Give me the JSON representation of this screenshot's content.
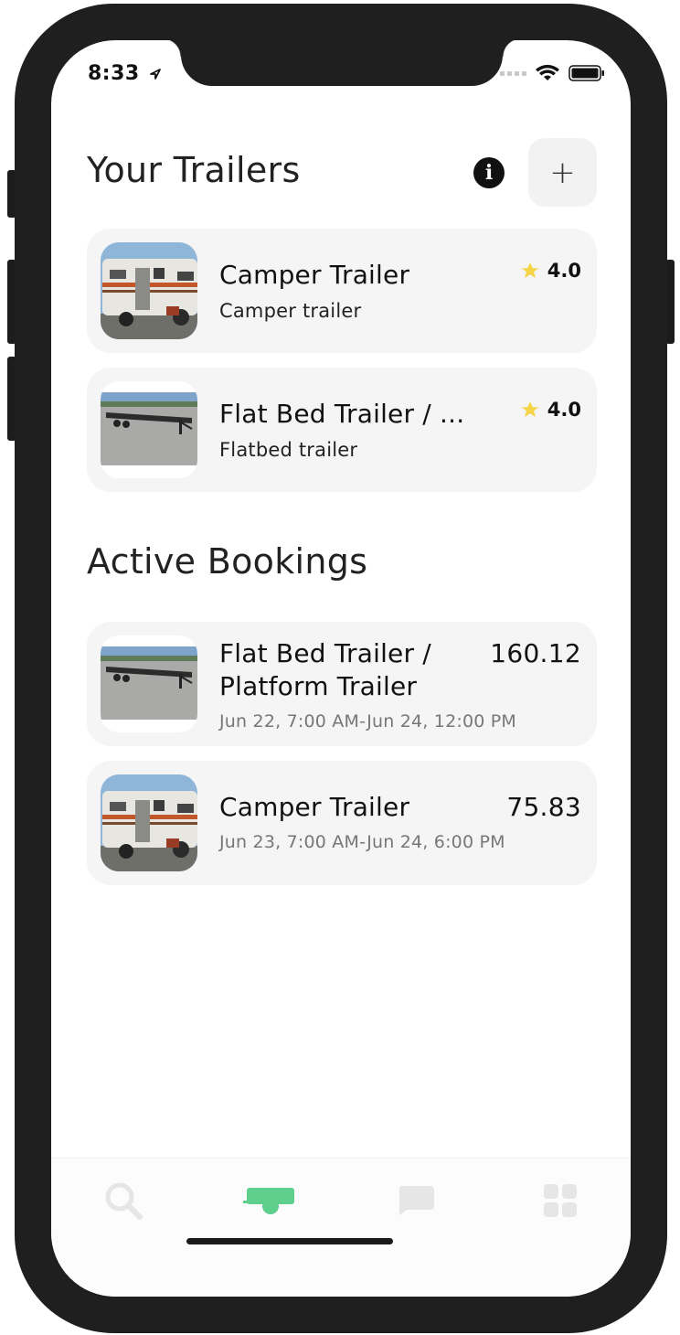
{
  "status_bar": {
    "time": "8:33"
  },
  "header": {
    "title": "Your Trailers",
    "add_label": "+"
  },
  "trailers": [
    {
      "title": "Camper Trailer",
      "subtitle": "Camper trailer",
      "rating": "4.0",
      "image": "camper"
    },
    {
      "title": "Flat Bed Trailer / ...",
      "subtitle": "Flatbed trailer",
      "rating": "4.0",
      "image": "flatbed"
    }
  ],
  "bookings_section": {
    "title": "Active Bookings"
  },
  "bookings": [
    {
      "title_line1": "Flat Bed Trailer /",
      "title_line2": "Platform Trailer",
      "price": "160.12",
      "dates": "Jun 22, 7:00 AM-Jun 24, 12:00 PM",
      "image": "flatbed"
    },
    {
      "title": "Camper Trailer",
      "price": "75.83",
      "dates": "Jun 23, 7:00 AM-Jun 24, 6:00 PM",
      "image": "camper"
    }
  ],
  "tabs": [
    {
      "icon": "search-icon",
      "active": false
    },
    {
      "icon": "trailer-icon",
      "active": true
    },
    {
      "icon": "chat-icon",
      "active": false
    },
    {
      "icon": "grid-icon",
      "active": false
    }
  ],
  "colors": {
    "accent": "#5fcf8e",
    "star": "#f5d547",
    "inactive_tab": "#e6e6e6",
    "card_bg": "#f5f5f5"
  }
}
